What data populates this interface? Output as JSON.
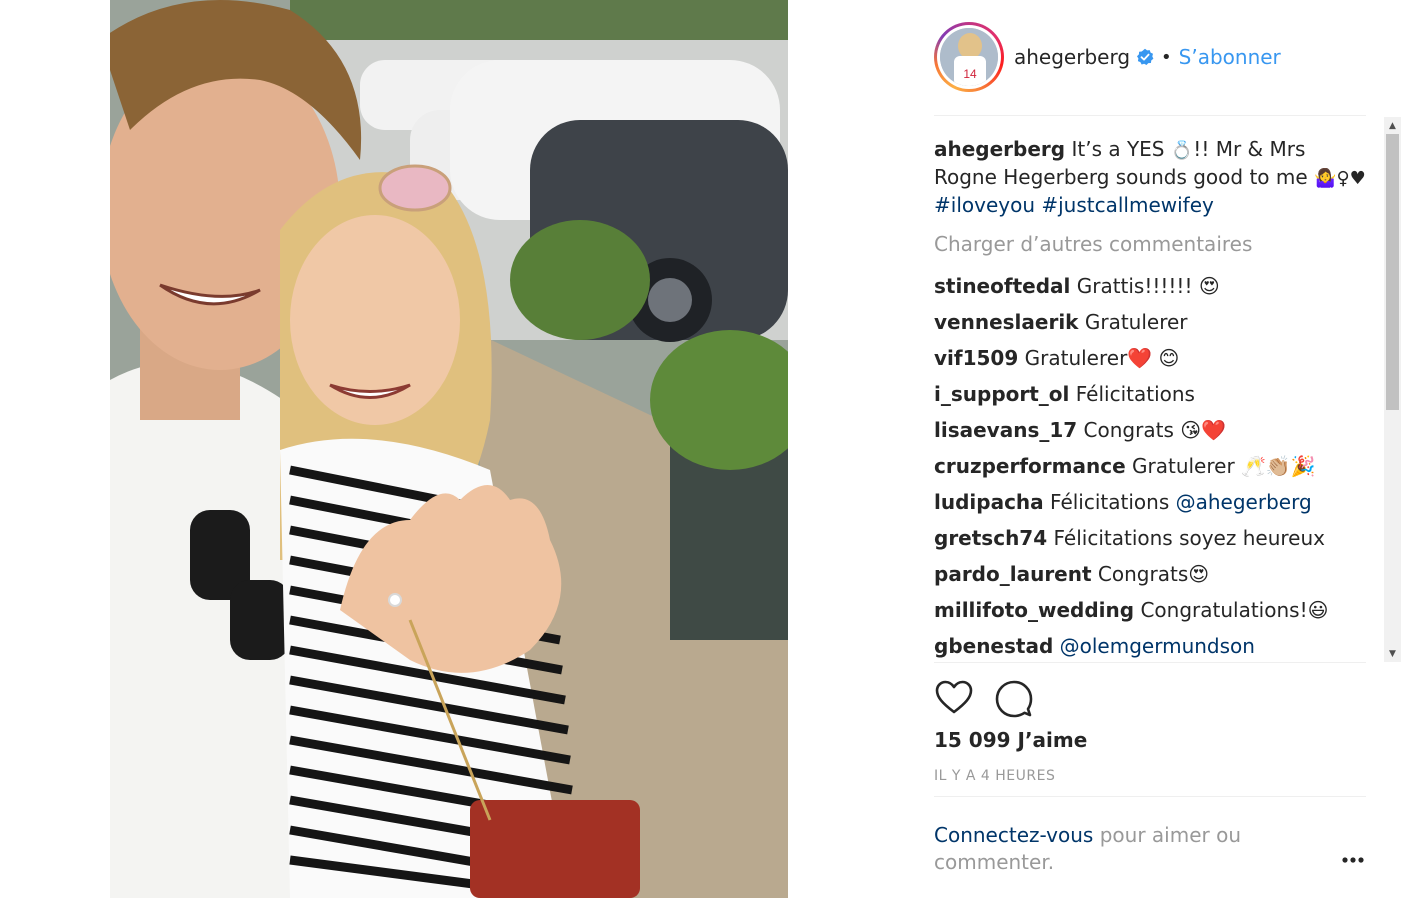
{
  "post": {
    "username": "ahegerberg",
    "follow_label": "S’abonner",
    "dot": "•",
    "avatar_jersey_number": "14"
  },
  "caption": {
    "username": "ahegerberg",
    "text_part1": "It’s a YES ",
    "text_part2": "!! Mr & Mrs Rogne Hegerberg sounds good to me ",
    "emoji_ring": "💍",
    "emoji_part": "🤷‍♀️♀♥",
    "hashtag1": "#iloveyou",
    "hashtag2": "#justcallmewifey"
  },
  "load_more": "Charger d’autres commentaires",
  "comments": [
    {
      "user": "stineoftedal",
      "text": "Grattis!!!!!! 😍"
    },
    {
      "user": "venneslaerik",
      "text": "Gratulerer"
    },
    {
      "user": "vif1509",
      "text": "Gratulerer❤️ 😊"
    },
    {
      "user": "i_support_ol",
      "text": "Félicitations"
    },
    {
      "user": "lisaevans_17",
      "text": "Congrats 😘❤️"
    },
    {
      "user": "cruzperformance",
      "text": "Gratulerer 🥂👏🏼🎉"
    },
    {
      "user": "ludipacha",
      "text": "Félicitations ",
      "mention": "@ahegerberg"
    },
    {
      "user": "gretsch74",
      "text": "Félicitations soyez heureux"
    },
    {
      "user": "pardo_laurent",
      "text": "Congrats😍"
    },
    {
      "user": "millifoto_wedding",
      "text": "Congratulations!😃"
    },
    {
      "user": "gbenestad",
      "text": "",
      "mention": "@olemgermundson"
    }
  ],
  "likes": "15 099 J’aime",
  "time": "IL Y A 4 HEURES",
  "login": {
    "link": "Connectez-vous",
    "rest": " pour aimer ou commenter."
  },
  "icons": {
    "like": "heart-icon",
    "comment": "comment-bubble-icon",
    "more": "more-options-icon",
    "verified": "verified-badge-icon"
  },
  "colors": {
    "link_blue": "#3897f0",
    "hashtag": "#003569",
    "muted": "#999999",
    "text": "#262626"
  }
}
